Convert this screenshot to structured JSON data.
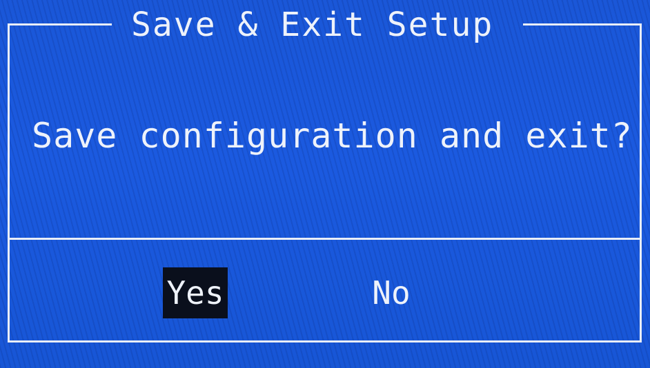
{
  "dialog": {
    "title": "Save & Exit Setup",
    "message": "Save configuration and exit?",
    "options": [
      {
        "label": "Yes",
        "selected": true
      },
      {
        "label": "No",
        "selected": false
      }
    ]
  },
  "colors": {
    "background": "#1b5ae0",
    "text": "#eef2fa",
    "border": "#e9eef7",
    "selection_highlight": "#0a0f1c"
  }
}
